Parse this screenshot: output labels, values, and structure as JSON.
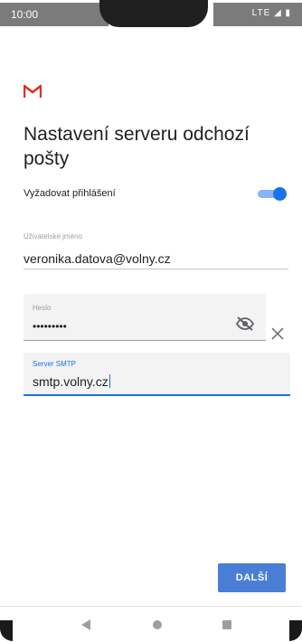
{
  "status_bar": {
    "time": "10:00",
    "indicators": "LTE ◢ ▮"
  },
  "logo": {
    "icon": "gmail-logo-icon",
    "color": "#d93025"
  },
  "screen": {
    "title": "Nastavení serveru odchozí pošty"
  },
  "require_login": {
    "label": "Vyžadovat přihlášení",
    "enabled": true,
    "accent": "#1a73e8"
  },
  "username": {
    "label": "Uživatelské jméno",
    "value": "veronika.datova@volny.cz"
  },
  "password": {
    "label": "Heslo",
    "value": "•••••••••",
    "visibility_icon": "eye-off-icon",
    "clear_icon": "close-icon"
  },
  "smtp": {
    "label": "Server SMTP",
    "value": "smtp.volny.cz"
  },
  "actions": {
    "next_label": "DALŠÍ",
    "accent": "#4a7ed6"
  },
  "nav": {
    "back_icon": "back-triangle-icon",
    "home_icon": "home-circle-icon",
    "recent_icon": "recents-square-icon"
  }
}
